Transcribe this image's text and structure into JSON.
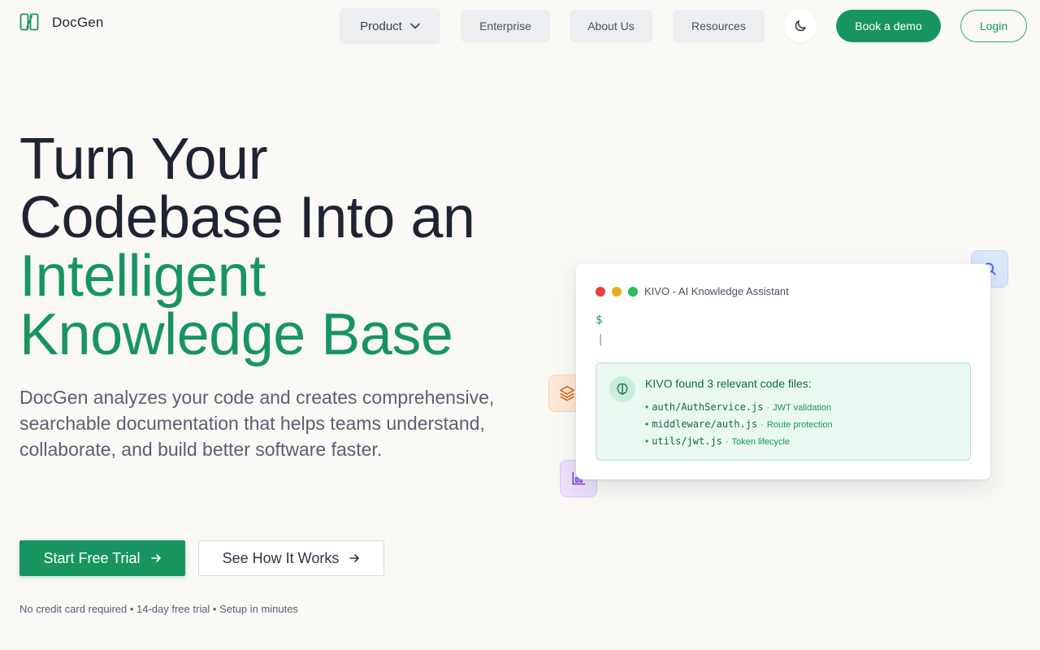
{
  "nav": {
    "brand": "DocGen",
    "items": [
      {
        "label": "Product"
      },
      {
        "label": "Enterprise"
      },
      {
        "label": "About Us"
      },
      {
        "label": "Resources"
      }
    ],
    "theme_toggle_icon": "moon-icon",
    "demo_label": "Book a demo",
    "login_label": "Login"
  },
  "hero": {
    "title_line1": "Turn Your",
    "title_line2": "Codebase Into an",
    "title_highlight1": "Intelligent",
    "title_highlight2": "Knowledge Base",
    "description": "DocGen analyzes your code and creates comprehensive, searchable documentation that helps teams understand, collaborate, and build better software faster.",
    "cta_primary": "Start Free Trial",
    "cta_secondary": "See How It Works",
    "fineprint": "No credit card required • 14-day free trial • Setup in minutes"
  },
  "terminal": {
    "title": "KIVO - AI Knowledge Assistant",
    "prompt": "$",
    "cursor": "|",
    "result_heading": "KIVO found 3 relevant code files:",
    "files": [
      {
        "path": "auth/AuthService.js",
        "desc": "JWT validation"
      },
      {
        "path": "middleware/auth.js",
        "desc": "Route protection"
      },
      {
        "path": "utils/jwt.js",
        "desc": "Token lifecycle"
      }
    ]
  },
  "colors": {
    "accent": "#18955f",
    "dot_red": "#e5413b",
    "dot_yellow": "#e5ad1a",
    "dot_green": "#2dba5a"
  },
  "icons": [
    "docgen-logo-icon",
    "chevron-down-icon",
    "moon-icon",
    "arrow-right-icon",
    "search-icon",
    "layers-icon",
    "chart-icon",
    "brain-icon"
  ]
}
